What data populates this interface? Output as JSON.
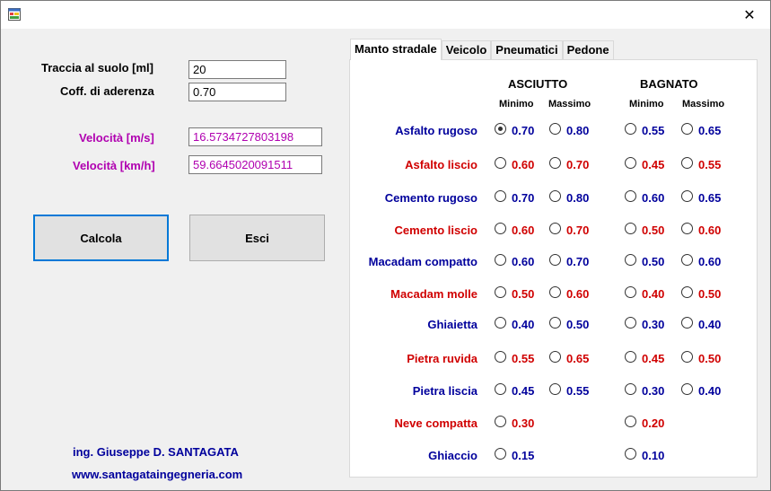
{
  "window": {
    "close_glyph": "✕",
    "icon": "app-form-icon"
  },
  "form": {
    "traccia_label": "Traccia al suolo [ml]",
    "traccia_value": "20",
    "aderenza_label": "Coff. di aderenza",
    "aderenza_value": "0.70",
    "vel_ms_label": "Velocità [m/s]",
    "vel_ms_value": "16.5734727803198",
    "vel_kmh_label": "Velocità [km/h]",
    "vel_kmh_value": "59.6645020091511",
    "calcola_label": "Calcola",
    "esci_label": "Esci",
    "author": "ing. Giuseppe D. SANTAGATA",
    "website": "www.santagataingegneria.com"
  },
  "tabs": [
    {
      "label": "Manto stradale",
      "active": true
    },
    {
      "label": "Veicolo",
      "active": false
    },
    {
      "label": "Pneumatici",
      "active": false
    },
    {
      "label": "Pedone",
      "active": false
    }
  ],
  "table": {
    "asciutto": "ASCIUTTO",
    "bagnato": "BAGNATO",
    "minimo": "Minimo",
    "massimo": "Massimo",
    "rows": [
      {
        "name": "Asfalto rugoso",
        "color": "blue",
        "vals": [
          "0.70",
          "0.80",
          "0.55",
          "0.65"
        ]
      },
      {
        "name": "Asfalto liscio",
        "color": "red",
        "vals": [
          "0.60",
          "0.70",
          "0.45",
          "0.55"
        ]
      },
      {
        "name": "Cemento rugoso",
        "color": "blue",
        "vals": [
          "0.70",
          "0.80",
          "0.60",
          "0.65"
        ]
      },
      {
        "name": "Cemento liscio",
        "color": "red",
        "vals": [
          "0.60",
          "0.70",
          "0.50",
          "0.60"
        ]
      },
      {
        "name": "Macadam compatto",
        "color": "blue",
        "vals": [
          "0.60",
          "0.70",
          "0.50",
          "0.60"
        ]
      },
      {
        "name": "Macadam molle",
        "color": "red",
        "vals": [
          "0.50",
          "0.60",
          "0.40",
          "0.50"
        ]
      },
      {
        "name": "Ghiaietta",
        "color": "blue",
        "vals": [
          "0.40",
          "0.50",
          "0.30",
          "0.40"
        ]
      },
      {
        "name": "Pietra ruvida",
        "color": "red",
        "vals": [
          "0.55",
          "0.65",
          "0.45",
          "0.50"
        ]
      },
      {
        "name": "Pietra liscia",
        "color": "blue",
        "vals": [
          "0.45",
          "0.55",
          "0.30",
          "0.40"
        ]
      },
      {
        "name": "Neve compatta",
        "color": "red",
        "vals": [
          "0.30",
          null,
          "0.20",
          null
        ]
      },
      {
        "name": "Ghiaccio",
        "color": "blue",
        "vals": [
          "0.15",
          null,
          "0.10",
          null
        ]
      }
    ],
    "selected": {
      "row": 0,
      "col": 0
    }
  },
  "colors": {
    "blue": "#00009c",
    "red": "#d00000",
    "purple": "#b000b0",
    "focus": "#0078d7"
  }
}
